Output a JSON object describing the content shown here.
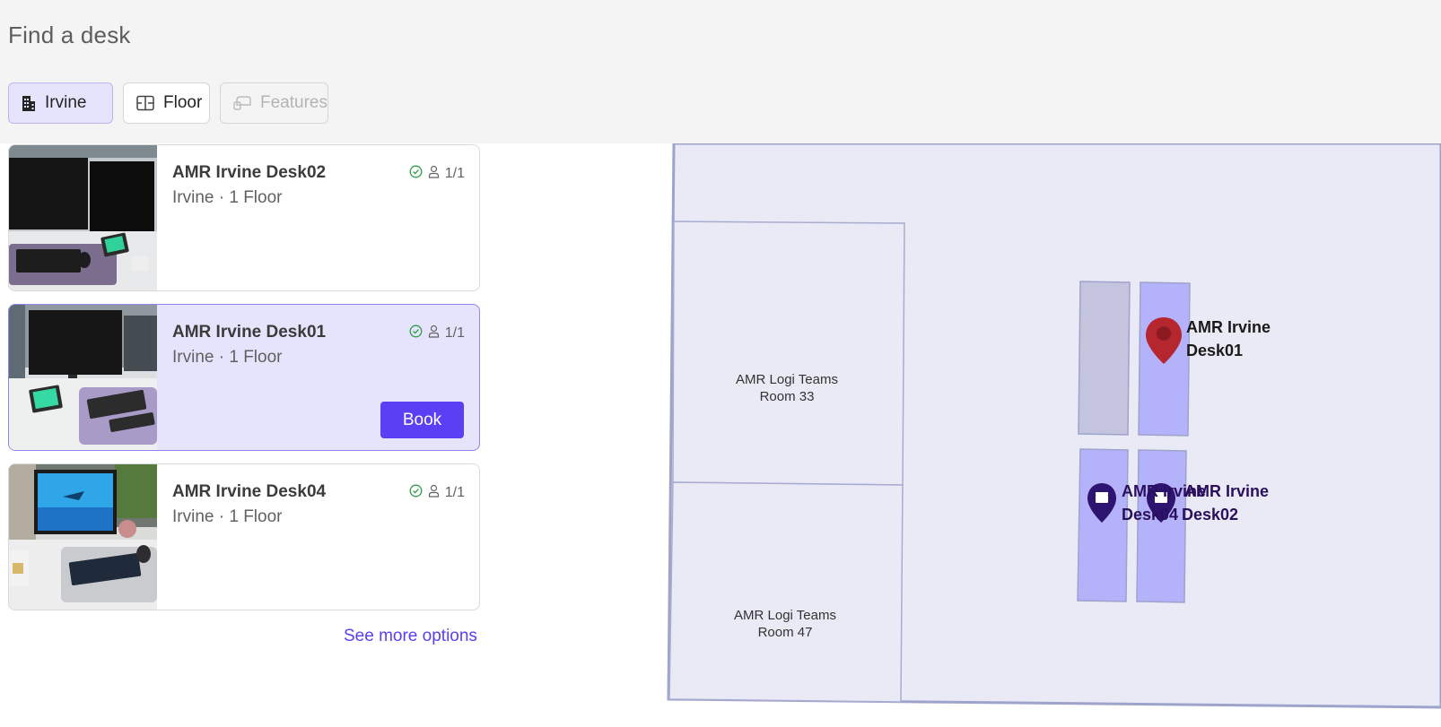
{
  "page": {
    "title": "Find a desk"
  },
  "filters": [
    {
      "label": "Irvine",
      "icon": "building-icon",
      "state": "selected"
    },
    {
      "label": "Floor",
      "icon": "floor-plan-icon",
      "state": "default"
    },
    {
      "label": "Features",
      "icon": "features-icon",
      "state": "disabled"
    }
  ],
  "desks": [
    {
      "name": "AMR Irvine Desk02",
      "location": "Irvine · 1 Floor",
      "capacity": "1/1",
      "selected": false
    },
    {
      "name": "AMR Irvine Desk01",
      "location": "Irvine · 1 Floor",
      "capacity": "1/1",
      "selected": true,
      "action": "Book"
    },
    {
      "name": "AMR Irvine Desk04",
      "location": "Irvine · 1 Floor",
      "capacity": "1/1",
      "selected": false
    }
  ],
  "see_more": "See more options",
  "map": {
    "rooms": [
      {
        "line1": "AMR Logi Teams",
        "line2": "Room 33"
      },
      {
        "line1": "AMR Logi Teams",
        "line2": "Room 47"
      }
    ],
    "pins": [
      {
        "line1": "AMR Irvine",
        "line2": "Desk01",
        "selected": true
      },
      {
        "line1": "AMR Irvine",
        "line2": "Desk04"
      },
      {
        "line1": "AMR Irvine",
        "line2": "Desk02"
      }
    ]
  },
  "colors": {
    "accent": "#5b3ff5",
    "selected_card": "#e6e4fc",
    "available_check": "#2e9e44",
    "map_background": "#e9eaf5",
    "desk_fill": "#b4b2fb",
    "desk_unavailable": "#c5c4de",
    "selected_pin": "#b5262f",
    "desk_pin": "#2c1470"
  }
}
